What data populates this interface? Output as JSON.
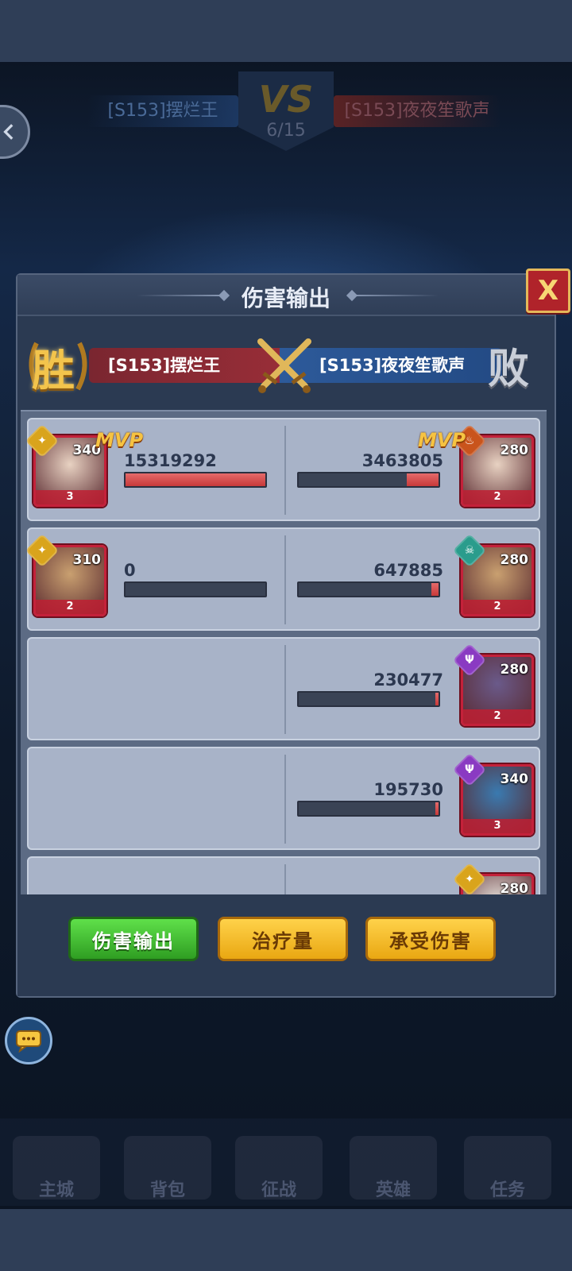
{
  "background": {
    "left_team": "[S153]摆烂王",
    "right_team": "[S153]夜夜笙歌声",
    "vs_label": "VS",
    "round": "6/15",
    "dock_items": [
      "主城",
      "背包",
      "征战",
      "英雄",
      "任务"
    ]
  },
  "modal": {
    "title": "伤害输出",
    "close_label": "X",
    "result_left": "胜",
    "result_right": "败",
    "team_left": "[S153]摆烂王",
    "team_right": "[S153]夜夜笙歌声",
    "mvp_label": "MVP",
    "rows": [
      {
        "left": {
          "level": "340",
          "stars": "3",
          "damage": "15319292",
          "fill": 1.0,
          "faction": "leaf",
          "faction_color": "#d9a41c",
          "mvp": true
        },
        "right": {
          "level": "280",
          "stars": "2",
          "damage": "3463805",
          "fill": 0.23,
          "faction": "fire",
          "faction_color": "#c9541c",
          "mvp": true
        }
      },
      {
        "left": {
          "level": "310",
          "stars": "2",
          "damage": "0",
          "fill": 0.0,
          "faction": "leaf",
          "faction_color": "#d9a41c",
          "mvp": false
        },
        "right": {
          "level": "280",
          "stars": "2",
          "damage": "647885",
          "fill": 0.05,
          "faction": "skull",
          "faction_color": "#2a9c8c",
          "mvp": false
        }
      },
      {
        "left": null,
        "right": {
          "level": "280",
          "stars": "2",
          "damage": "230477",
          "fill": 0.02,
          "faction": "trident",
          "faction_color": "#8a3ac2",
          "mvp": false
        }
      },
      {
        "left": null,
        "right": {
          "level": "340",
          "stars": "3",
          "damage": "195730",
          "fill": 0.02,
          "faction": "trident",
          "faction_color": "#8a3ac2",
          "mvp": false
        }
      },
      {
        "left": null,
        "right": {
          "level": "280",
          "stars": "",
          "damage": "",
          "fill": 0.0,
          "faction": "leaf",
          "faction_color": "#d9a41c",
          "mvp": false
        }
      }
    ],
    "tabs": [
      {
        "label": "伤害输出",
        "active": true
      },
      {
        "label": "治疗量",
        "active": false
      },
      {
        "label": "承受伤害",
        "active": false
      }
    ]
  },
  "colors": {
    "bar_fill": "#d84a4a",
    "win_gold": "#f3c44c",
    "tab_active": "#3fbf2f",
    "tab_inactive": "#f4bb26"
  }
}
